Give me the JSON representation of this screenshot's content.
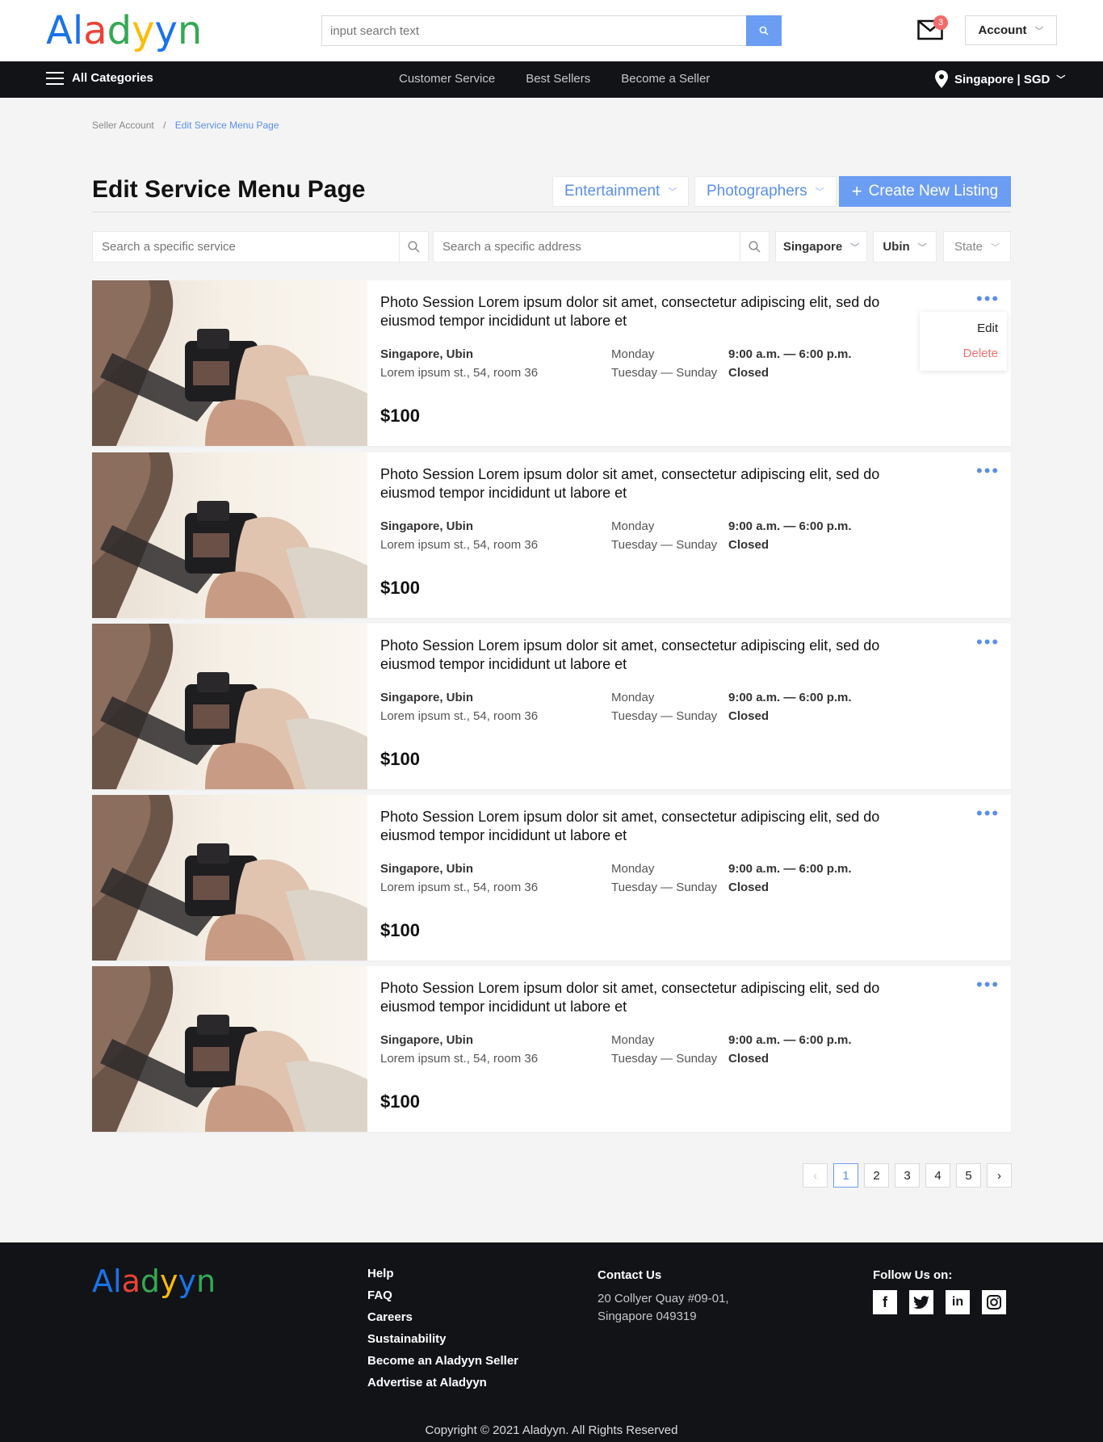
{
  "header": {
    "logo_letters": [
      "A",
      "l",
      "a",
      "d",
      "y",
      "y",
      "n"
    ],
    "logo_colors": [
      "#1a73e8",
      "#1a73e8",
      "#ea4335",
      "#34a853",
      "#fbbc05",
      "#1a73e8",
      "#34a853"
    ],
    "search_placeholder": "input search text",
    "mail_count": "3",
    "account_label": "Account"
  },
  "nav": {
    "categories": "All Categories",
    "links": [
      "Customer Service",
      "Best Sellers",
      "Become a Seller"
    ],
    "region": "Singapore | SGD"
  },
  "breadcrumb": {
    "parent": "Seller Account",
    "separator": "/",
    "current": "Edit Service Menu Page"
  },
  "page": {
    "title": "Edit Service Menu Page",
    "category_dropdown": "Entertainment",
    "subcategory_dropdown": "Photographers",
    "create_button": "Create New Listing"
  },
  "filters": {
    "service_placeholder": "Search a specific service",
    "address_placeholder": "Search a specific address",
    "country": "Singapore",
    "city": "Ubin",
    "state": "State"
  },
  "listings": [
    {
      "title": "Photo Session Lorem ipsum dolor sit amet, consectetur adipiscing elit, sed do eiusmod tempor incididunt ut labore et",
      "location": "Singapore, Ubin",
      "address": "Lorem ipsum st., 54, room 36",
      "day1": "Monday",
      "day2": "Tuesday — Sunday",
      "hours1": "9:00 a.m. — 6:00 p.m.",
      "hours2": "Closed",
      "price": "$100"
    },
    {
      "title": "Photo Session Lorem ipsum dolor sit amet, consectetur adipiscing elit, sed do eiusmod tempor incididunt ut labore et",
      "location": "Singapore, Ubin",
      "address": "Lorem ipsum st., 54, room 36",
      "day1": "Monday",
      "day2": "Tuesday — Sunday",
      "hours1": "9:00 a.m. — 6:00 p.m.",
      "hours2": "Closed",
      "price": "$100"
    },
    {
      "title": "Photo Session Lorem ipsum dolor sit amet, consectetur adipiscing elit, sed do eiusmod tempor incididunt ut labore et",
      "location": "Singapore, Ubin",
      "address": "Lorem ipsum st., 54, room 36",
      "day1": "Monday",
      "day2": "Tuesday — Sunday",
      "hours1": "9:00 a.m. — 6:00 p.m.",
      "hours2": "Closed",
      "price": "$100"
    },
    {
      "title": "Photo Session Lorem ipsum dolor sit amet, consectetur adipiscing elit, sed do eiusmod tempor incididunt ut labore et",
      "location": "Singapore, Ubin",
      "address": "Lorem ipsum st., 54, room 36",
      "day1": "Monday",
      "day2": "Tuesday — Sunday",
      "hours1": "9:00 a.m. — 6:00 p.m.",
      "hours2": "Closed",
      "price": "$100"
    },
    {
      "title": "Photo Session Lorem ipsum dolor sit amet, consectetur adipiscing elit, sed do eiusmod tempor incididunt ut labore et",
      "location": "Singapore, Ubin",
      "address": "Lorem ipsum st., 54, room 36",
      "day1": "Monday",
      "day2": "Tuesday — Sunday",
      "hours1": "9:00 a.m. — 6:00 p.m.",
      "hours2": "Closed",
      "price": "$100"
    }
  ],
  "context_menu": {
    "edit": "Edit",
    "delete": "Delete"
  },
  "pagination": {
    "prev": "‹",
    "pages": [
      "1",
      "2",
      "3",
      "4",
      "5"
    ],
    "next": "›",
    "active": "1"
  },
  "footer": {
    "links": [
      "Help",
      "FAQ",
      "Careers",
      "Sustainability",
      "Become an Aladyyn Seller",
      "Advertise at Aladyyn"
    ],
    "contact_heading": "Contact Us",
    "address_line1": "20 Collyer Quay #09-01,",
    "address_line2": "Singapore 049319",
    "follow_heading": "Follow Us on:",
    "social": [
      "facebook-icon",
      "twitter-icon",
      "linkedin-icon",
      "instagram-icon"
    ],
    "copyright": "Copyright © 2021 Aladyyn. All Rights Reserved"
  },
  "colors": {
    "accent": "#6b9df2",
    "danger": "#f07070",
    "dark": "#111317"
  }
}
